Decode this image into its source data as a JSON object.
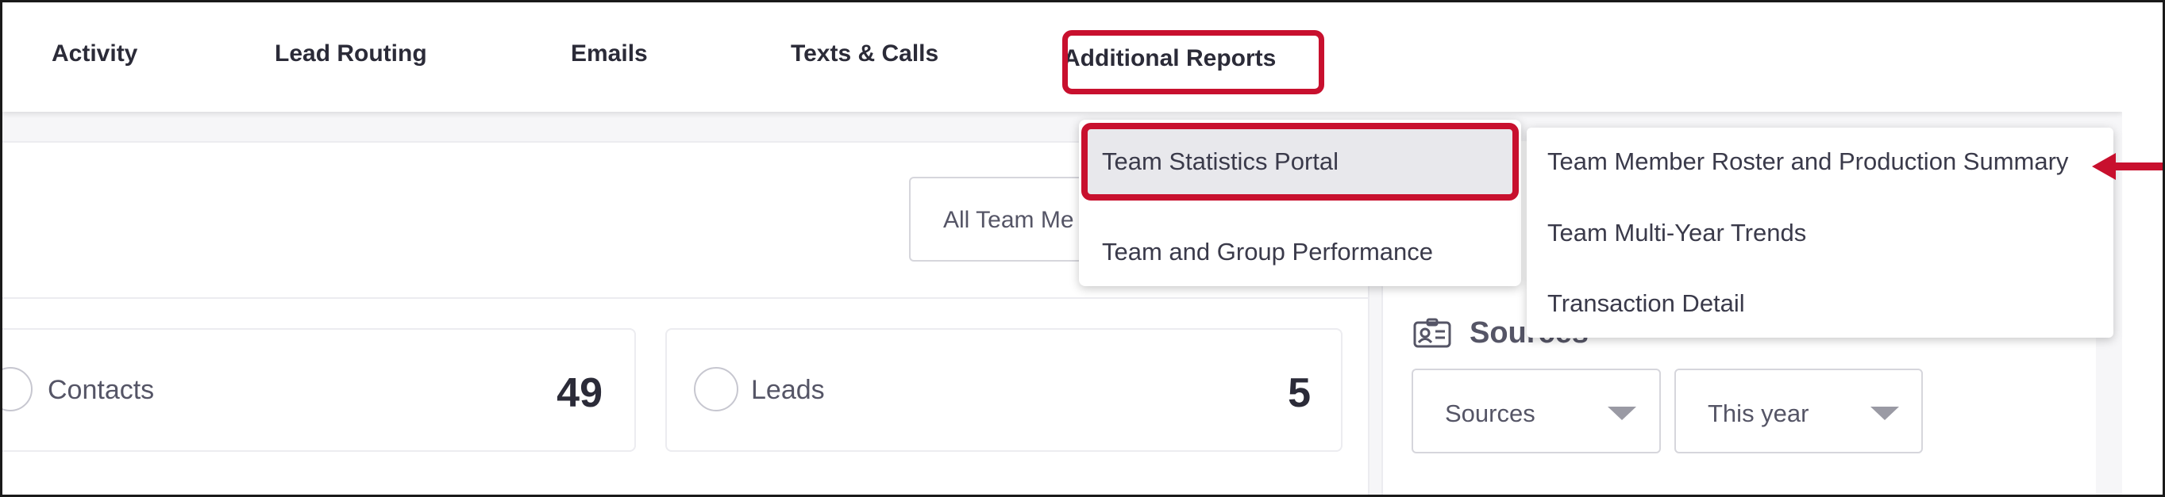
{
  "nav": {
    "items": [
      {
        "label": "Activity"
      },
      {
        "label": "Lead Routing"
      },
      {
        "label": "Emails"
      },
      {
        "label": "Texts & Calls"
      },
      {
        "label": "Additional Reports",
        "highlighted": true
      }
    ]
  },
  "filters": {
    "team_member_select": "All Team Me"
  },
  "stats": [
    {
      "label": "Contacts",
      "value": "49"
    },
    {
      "label": "Leads",
      "value": "5"
    }
  ],
  "sources": {
    "title": "Sources",
    "icon": "contact-card-icon",
    "source_select": "Sources",
    "period_select": "This year"
  },
  "reports_menu": {
    "items": [
      {
        "label": "Team Statistics Portal",
        "highlighted": true
      },
      {
        "label": "Team and Group Performance"
      }
    ],
    "submenu": [
      {
        "label": "Team Member Roster and Production Summary"
      },
      {
        "label": "Team Multi-Year Trends"
      },
      {
        "label": "Transaction Detail"
      }
    ]
  },
  "colors": {
    "highlight": "#c8102e",
    "text": "#2b2b38",
    "muted_text": "#555566"
  }
}
